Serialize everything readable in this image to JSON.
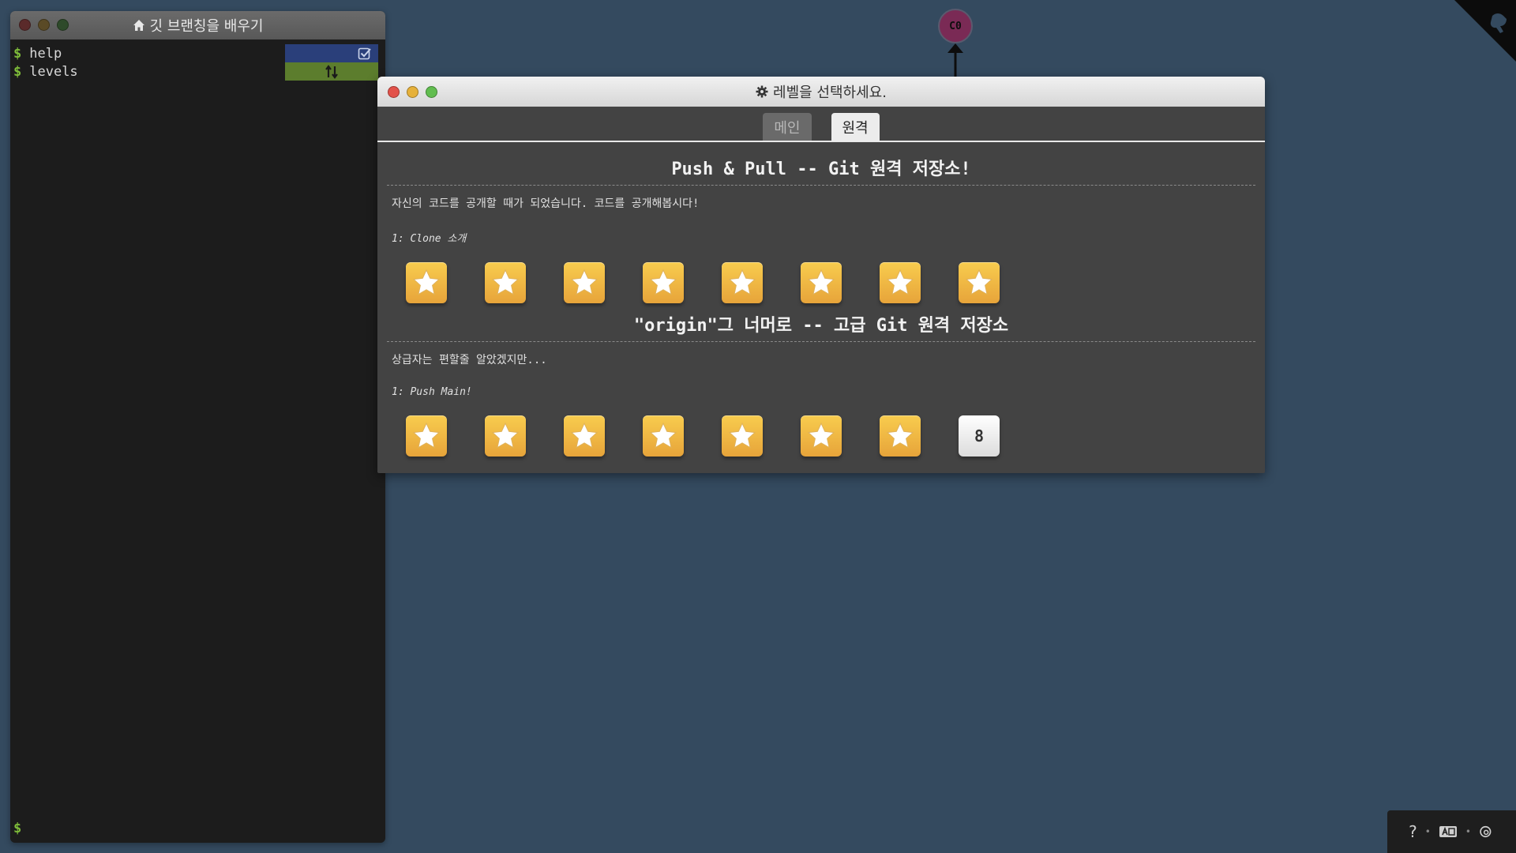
{
  "terminal": {
    "title": "깃 브랜칭을 배우기",
    "prompt": "$",
    "commands": [
      {
        "text": "help",
        "status": "done"
      },
      {
        "text": "levels",
        "status": "running"
      }
    ]
  },
  "commit": {
    "label": "C0"
  },
  "dialog": {
    "title": "레벨을 선택하세요.",
    "tabs": [
      {
        "label": "메인",
        "active": false
      },
      {
        "label": "원격",
        "active": true
      }
    ],
    "sequences": [
      {
        "title": "Push & Pull -- Git 원격 저장소!",
        "about": "자신의 코드를 공개할 때가 되었습니다. 코드를 공개해봅시다!",
        "sublabel": "1: Clone 소개",
        "levels": [
          "star",
          "star",
          "star",
          "star",
          "star",
          "star",
          "star",
          "star"
        ]
      },
      {
        "title": "\"origin\"그 너머로 -- 고급 Git 원격 저장소",
        "about": "상급자는 편할줄 알았겠지만...",
        "sublabel": "1: Push Main!",
        "levels": [
          "star",
          "star",
          "star",
          "star",
          "star",
          "star",
          "star",
          "8"
        ]
      }
    ]
  },
  "toolbar": {
    "help": "?"
  },
  "colors": {
    "background": "#344a5f",
    "star_level": "#f2b845",
    "commit_node": "#7a2a55",
    "prompt": "#7fbd3a"
  }
}
